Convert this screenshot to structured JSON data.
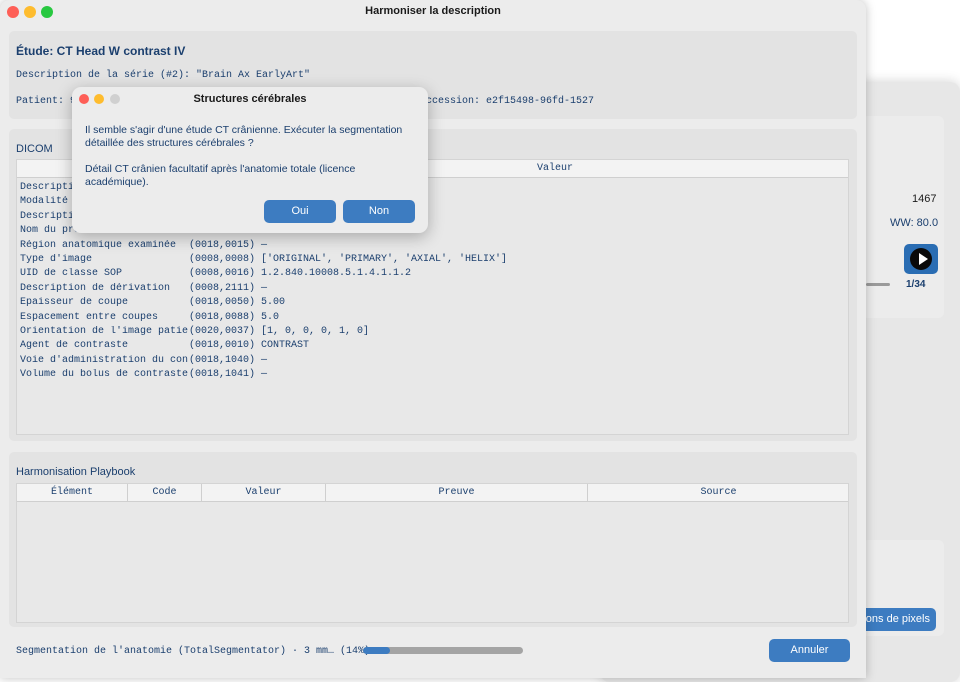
{
  "window": {
    "title": "Harmoniser la description"
  },
  "study": {
    "title": "Étude: CT Head W contrast IV",
    "series_description": "Description de la série (#2): \"Brain Ax EarlyArt\"",
    "patient_label": "Patient: 9",
    "accession": "ccession: e2f15498-96fd-1527"
  },
  "dicom": {
    "label": "DICOM",
    "value_header": "Valeur",
    "rows": [
      {
        "name": "Descripti",
        "tag": "",
        "value": ""
      },
      {
        "name": "Modalité",
        "tag": "",
        "value": ""
      },
      {
        "name": "Descripti",
        "tag": "",
        "value": ""
      },
      {
        "name": "Nom du pro",
        "tag": "",
        "value": ""
      },
      {
        "name": "Région anatomique examinée",
        "tag": "(0018,0015)",
        "value": "—"
      },
      {
        "name": "Type d'image",
        "tag": "(0008,0008)",
        "value": "['ORIGINAL', 'PRIMARY', 'AXIAL', 'HELIX']"
      },
      {
        "name": "UID de classe SOP",
        "tag": "(0008,0016)",
        "value": "1.2.840.10008.5.1.4.1.1.2"
      },
      {
        "name": "Description de dérivation",
        "tag": "(0008,2111)",
        "value": "—"
      },
      {
        "name": "Épaisseur de coupe",
        "tag": "(0018,0050)",
        "value": "5.00"
      },
      {
        "name": "Espacement entre coupes",
        "tag": "(0018,0088)",
        "value": "5.0"
      },
      {
        "name": "Orientation de l'image patien",
        "tag": "(0020,0037)",
        "value": "[1, 0, 0, 0, 1, 0]"
      },
      {
        "name": "Agent de contraste",
        "tag": "(0018,0010)",
        "value": "CONTRAST"
      },
      {
        "name": "Voie d'administration du cont",
        "tag": "(0018,1040)",
        "value": "—"
      },
      {
        "name": "Volume du bolus de contraste",
        "tag": "(0018,1041)",
        "value": "—"
      }
    ]
  },
  "playbook": {
    "label": "Harmonisation Playbook",
    "columns": [
      "Élément",
      "Code",
      "Valeur",
      "Preuve",
      "Source"
    ]
  },
  "status": {
    "text": "Segmentation de l'anatomie (TotalSegmentator) · 3 mm… (14%)",
    "progress": 0.17
  },
  "cancel_label": "Annuler",
  "dialog": {
    "title": "Structures cérébrales",
    "message": "Il semble s'agir d'une étude CT crânienne. Exécuter la segmentation détaillée des structures cérébrales ?",
    "detail": "Détail CT crânien facultatif après l'anatomie totale (licence académique).",
    "yes_label": "Oui",
    "no_label": "Non"
  },
  "background_window": {
    "wl_value": "1467",
    "ww_label": "WW: 80.0",
    "frame_counter": "1/34",
    "pixel_button_label": "ons de pixels"
  },
  "colors": {
    "accent": "#3d7cc1",
    "text": "#1b3f6e",
    "window_bg": "#ececec",
    "panel_bg": "#e3e3e3"
  }
}
